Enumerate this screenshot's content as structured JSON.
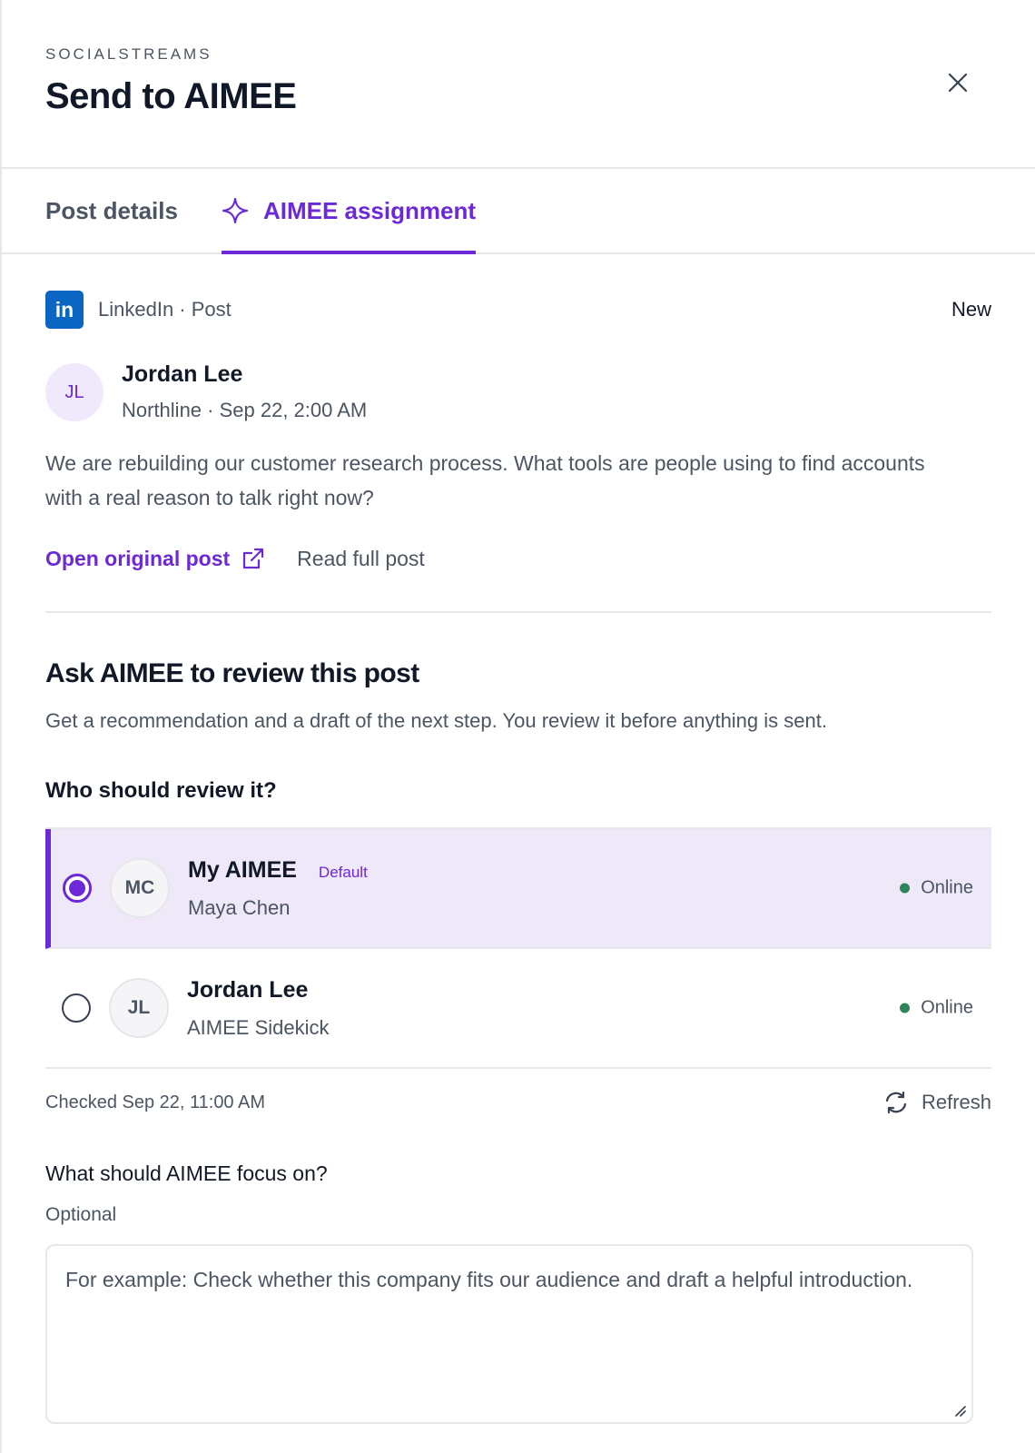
{
  "header": {
    "eyebrow": "SOCIALSTREAMS",
    "title": "Send to AIMEE",
    "close_icon": "close-icon"
  },
  "tabs": [
    {
      "label": "Post details",
      "active": false
    },
    {
      "label": "AIMEE assignment",
      "active": true,
      "icon": "sparkle-icon"
    }
  ],
  "post": {
    "platform_badge": "in",
    "source": "LinkedIn · Post",
    "status": "New",
    "author": {
      "initials": "JL",
      "name": "Jordan Lee",
      "meta": "Northline · Sep 22, 2:00 AM"
    },
    "body": "We are rebuilding our customer research process. What tools are people using to find accounts with a real reason to talk right now?",
    "open_original": "Open original post",
    "read_full": "Read full post"
  },
  "review": {
    "title": "Ask AIMEE to review this post",
    "subtitle": "Get a recommendation and a draft of the next step. You review it before anything is sent.",
    "who_label": "Who should review it?",
    "reviewers": [
      {
        "initials": "MC",
        "name": "My AIMEE",
        "badge": "Default",
        "sub": "Maya Chen",
        "status": "Online",
        "selected": true
      },
      {
        "initials": "JL",
        "name": "Jordan Lee",
        "badge": "",
        "sub": "AIMEE Sidekick",
        "status": "Online",
        "selected": false
      }
    ],
    "checked": "Checked Sep 22, 11:00 AM",
    "refresh": "Refresh"
  },
  "focus": {
    "label": "What should AIMEE focus on?",
    "optional": "Optional",
    "placeholder": "For example: Check whether this company fits our audience and draft a helpful introduction."
  },
  "colors": {
    "accent": "#6d28d9",
    "linkedin": "#0a66c2",
    "online": "#2f855a",
    "selected_bg": "#efe8f8"
  }
}
